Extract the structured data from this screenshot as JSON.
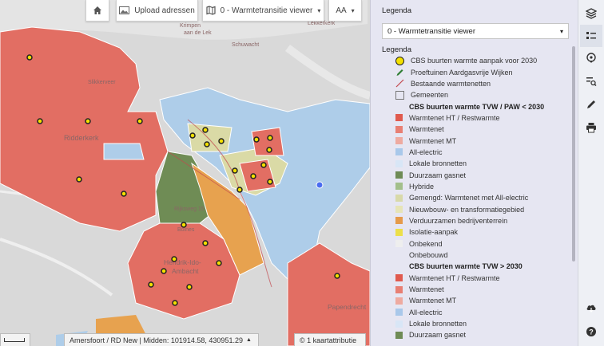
{
  "toolbar": {
    "upload_label": "Upload adressen",
    "viewer_label": "0 - Warmtetransitie viewer",
    "text_size_label": "AA"
  },
  "legend": {
    "title": "Legenda",
    "selected_viewer": "0 - Warmtetransitie viewer",
    "heading": "Legenda",
    "items": [
      {
        "kind": "dot",
        "label": "CBS buurten warmte aanpak voor 2030"
      },
      {
        "kind": "pen",
        "label": "Proeftuinen Aardgasvrije Wijken",
        "color": "#2e7d32"
      },
      {
        "kind": "line",
        "label": "Bestaande warmtenetten",
        "color": "#c2484f"
      },
      {
        "kind": "box",
        "label": "Gemeenten"
      },
      {
        "kind": "head",
        "label": "CBS buurten warmte TVW / PAW < 2030"
      },
      {
        "kind": "sw",
        "label": "Warmtenet HT / Restwarmte",
        "color": "#e05a4e"
      },
      {
        "kind": "sw",
        "label": "Warmtenet",
        "color": "#e87f73"
      },
      {
        "kind": "sw",
        "label": "Warmtenet MT",
        "color": "#eeaaa0"
      },
      {
        "kind": "sw",
        "label": "All-electric",
        "color": "#a9c8ea"
      },
      {
        "kind": "sw",
        "label": "Lokale bronnetten",
        "color": "#d8e6f6"
      },
      {
        "kind": "sw",
        "label": "Duurzaam gasnet",
        "color": "#6e8b55"
      },
      {
        "kind": "sw",
        "label": "Hybride",
        "color": "#a3bf8b"
      },
      {
        "kind": "sw",
        "label": "Gemengd: Warmtenet met All-electric",
        "color": "#d8d9a9"
      },
      {
        "kind": "sw",
        "label": "Nieuwbouw- en transformatiegebied",
        "color": "#e6e4b6"
      },
      {
        "kind": "sw",
        "label": "Verduurzamen bedrijventerrein",
        "color": "#e59a4a"
      },
      {
        "kind": "sw",
        "label": "Isolatie-aanpak",
        "color": "#ecdf4a"
      },
      {
        "kind": "sw",
        "label": "Onbekend",
        "color": "#eeeeee"
      },
      {
        "kind": "sw",
        "label": "Onbebouwd",
        "color": "#e6e6f2"
      },
      {
        "kind": "head",
        "label": "CBS buurten warmte TVW > 2030"
      },
      {
        "kind": "sw",
        "label": "Warmtenet HT / Restwarmte",
        "color": "#e05a4e"
      },
      {
        "kind": "sw",
        "label": "Warmtenet",
        "color": "#e87f73"
      },
      {
        "kind": "sw",
        "label": "Warmtenet MT",
        "color": "#eeaaa0"
      },
      {
        "kind": "sw",
        "label": "All-electric",
        "color": "#a9c8ea"
      },
      {
        "kind": "sw",
        "label": "Lokale bronnetten",
        "color": "#d8e6f6"
      },
      {
        "kind": "sw",
        "label": "Duurzaam gasnet",
        "color": "#6e8b55"
      }
    ]
  },
  "status": {
    "projection": "Amersfoort / RD New | Midden: 101914.58, 430951.29",
    "attribution": "© 1 kaartattributie"
  },
  "map_labels": {
    "krimpen": "Krimpen",
    "aan_de_lek": "aan de Lek",
    "lekkerkerk": "Lekkerkerk",
    "schuwacht": "Schuwacht",
    "ridderkerk": "Ridderkerk",
    "slikkerveer": "Slikkerveer",
    "rijksweg": "Rijksweg 15",
    "hendrik": "Hendrik-Ido-",
    "ambacht": "Ambacht",
    "bolnes": "Bolnes",
    "papendrecht": "Papendrecht"
  },
  "colors": {
    "red": "#e26e63",
    "blue": "#aecde9",
    "orange": "#e7a24f",
    "green": "#6f8c55",
    "khaki": "#dadaa6"
  }
}
